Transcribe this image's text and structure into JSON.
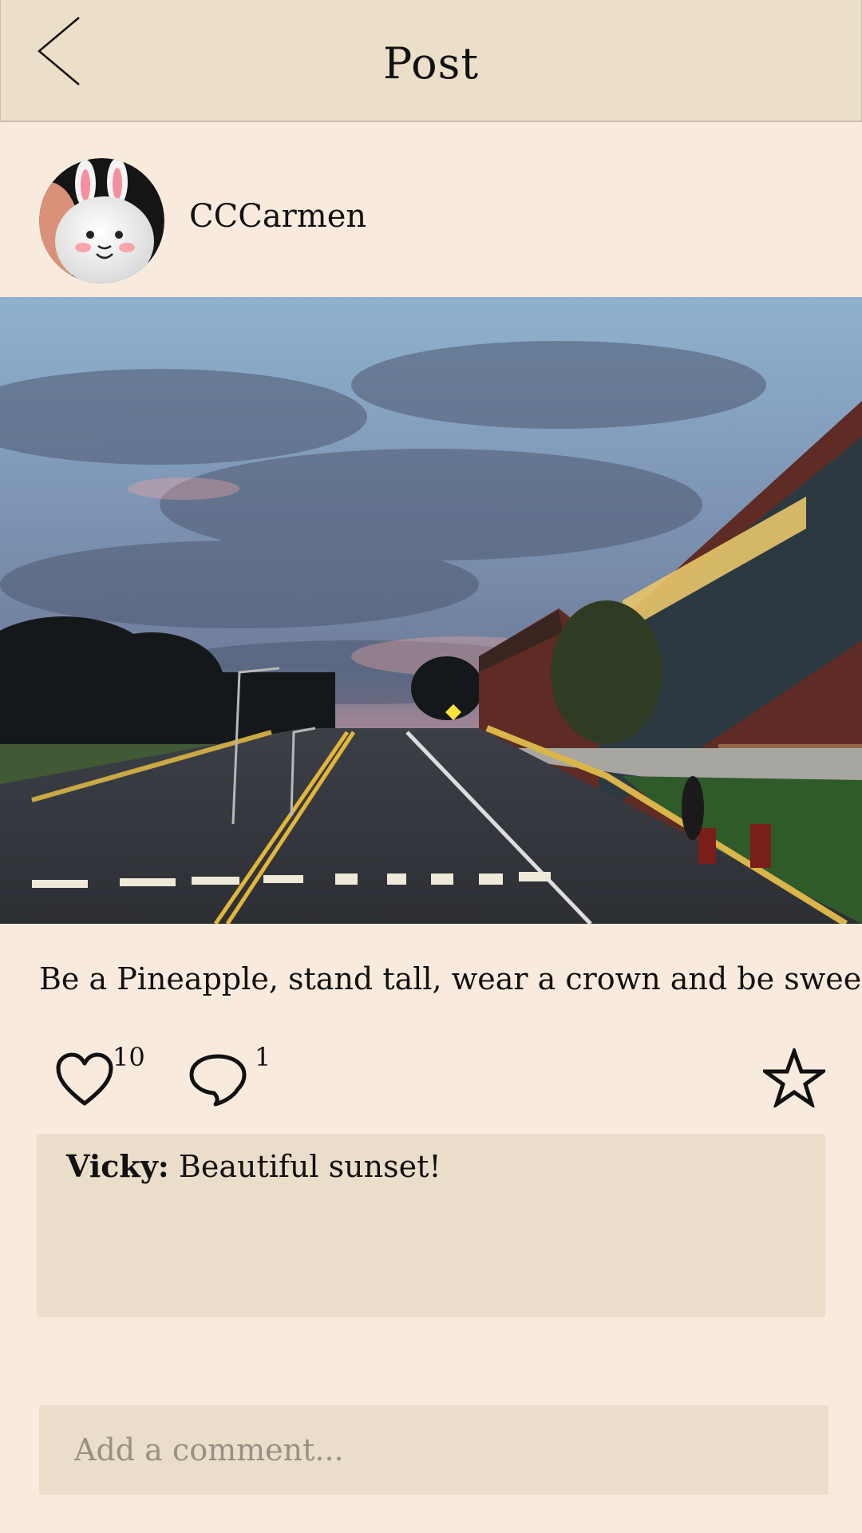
{
  "header": {
    "title": "Post"
  },
  "post": {
    "username": "CCCarmen",
    "caption": "Be a Pineapple, stand tall, wear a crown and be sweet.",
    "likes": "10",
    "comments_count": "1"
  },
  "comments": [
    {
      "author": "Vicky:",
      "text": "Beautiful sunset!"
    }
  ],
  "composer": {
    "placeholder": "Add a comment..."
  },
  "icons": {
    "back": "back-arrow-icon",
    "like": "heart-icon",
    "comment": "speech-bubble-icon",
    "favorite": "star-icon"
  },
  "colors": {
    "background": "#f8ebde",
    "header": "#ebdfca",
    "comment_box": "#eaddca"
  }
}
